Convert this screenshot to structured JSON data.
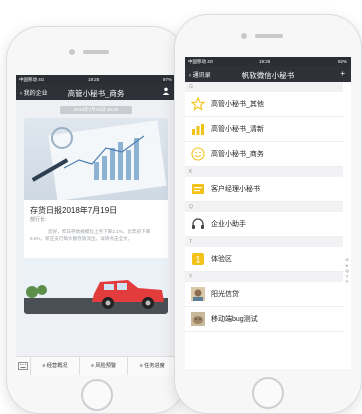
{
  "left_phone": {
    "status": {
      "carrier": "中国移动 4G",
      "time": "19:25",
      "battery": "97%"
    },
    "nav": {
      "back": "我的企业",
      "title": "高管小秘书_商务"
    },
    "date_label": "2018年7月19日 16:29",
    "card": {
      "title": "存货日报2018年7月19日",
      "subtitle": "部行长:",
      "body": "您好，昨日存款规模比上月下降2.1%，比年初下降8.6%，新庄支行每大额存款流出，详请点击全文。"
    },
    "menu": [
      "经营概况",
      "风险预警",
      "任务进度"
    ]
  },
  "right_phone": {
    "status": {
      "carrier": "中国移动 4G",
      "time": "19:25",
      "battery": "92%"
    },
    "nav": {
      "back": "通讯录",
      "title": "帆软微信小秘书",
      "action": "+"
    },
    "sections": [
      {
        "letter": "G",
        "items": [
          {
            "label": "高管小秘书_其他",
            "icon": "star-icon"
          },
          {
            "label": "高管小秘书_清新",
            "icon": "bar-chart-icon"
          },
          {
            "label": "高管小秘书_商务",
            "icon": "smiley-icon"
          }
        ]
      },
      {
        "letter": "K",
        "items": [
          {
            "label": "客户经理小秘书",
            "icon": "flag-icon"
          }
        ]
      },
      {
        "letter": "Q",
        "items": [
          {
            "label": "企业小助手",
            "icon": "headset-icon"
          }
        ]
      },
      {
        "letter": "T",
        "items": [
          {
            "label": "体验区",
            "icon": "number-badge-icon"
          }
        ]
      },
      {
        "letter": "Y",
        "items": [
          {
            "label": "阳光信贷",
            "icon": "photo-avatar-icon"
          },
          {
            "label": "移动端bug测试",
            "icon": "photo-avatar-icon"
          }
        ]
      }
    ],
    "index_letters": [
      "G",
      "K",
      "Q",
      "T",
      "Y"
    ]
  },
  "colors": {
    "nav": "#2e3238",
    "accent_yellow": "#f3c21a",
    "car_red": "#e23c3c",
    "road": "#4a4f56"
  }
}
